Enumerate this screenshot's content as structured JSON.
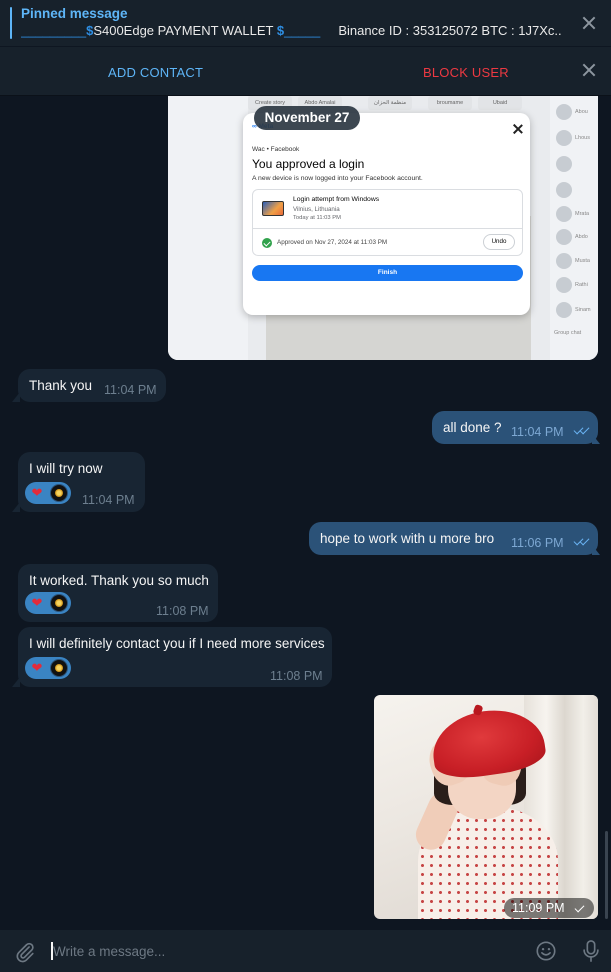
{
  "pinned": {
    "title": "Pinned message",
    "text_prefix": "_________",
    "text_main": "S400Edge PAYMENT WALLET",
    "text_mid": "_____",
    "text_tail": "Binance ID : 353125072  BTC : 1J7Xc..."
  },
  "actions": {
    "add_contact": "ADD CONTACT",
    "block_user": "BLOCK USER"
  },
  "date_pill": "November 27",
  "screenshot": {
    "brand": "∞ Meta",
    "sub": "Wac • Facebook",
    "title": "You approved a login",
    "desc": "A new device is now logged into your Facebook account.",
    "card_title": "Login attempt from Windows",
    "card_location": "Vilnius, Lithuania",
    "card_time": "Today at 11:03 PM",
    "approved": "Approved on Nov 27, 2024 at 11:03 PM",
    "undo": "Undo",
    "finish": "Finish",
    "tabs": [
      "Create story",
      "Abdo Amalai",
      "منظمة الحزان",
      "broumame",
      "Ubaid"
    ],
    "side_names": [
      "Abou",
      "Lhous",
      "",
      "",
      "Mrata",
      "Abdo",
      "Musta",
      "Rathi",
      "Sinam"
    ],
    "group_chats": "Group chat"
  },
  "messages": [
    {
      "dir": "in",
      "text": "Thank you",
      "time": "11:04 PM"
    },
    {
      "dir": "out",
      "text": "all done ?",
      "time": "11:04 PM"
    },
    {
      "dir": "in",
      "text": "I will try now",
      "time": "11:04 PM"
    },
    {
      "dir": "out",
      "text": "hope to work with u more bro",
      "time": "11:06 PM"
    },
    {
      "dir": "in",
      "text": "It worked. Thank you so much",
      "time": "11:08 PM"
    },
    {
      "dir": "in",
      "text": "I will definitely contact you if I need more services",
      "time": "11:08 PM"
    }
  ],
  "photo_time": "11:09 PM",
  "reaction_emoji": "❤",
  "input": {
    "placeholder": "Write a message..."
  },
  "colors": {
    "background": "#0e1621",
    "panel": "#17212b",
    "incoming_bubble": "#182533",
    "outgoing_bubble": "#2b5278",
    "accent": "#5eb5f7",
    "danger": "#ec3942"
  },
  "icons": {
    "attach": "paperclip-icon",
    "emoji": "smile-icon",
    "voice": "microphone-icon",
    "close": "close-icon",
    "read": "double-check-icon"
  }
}
